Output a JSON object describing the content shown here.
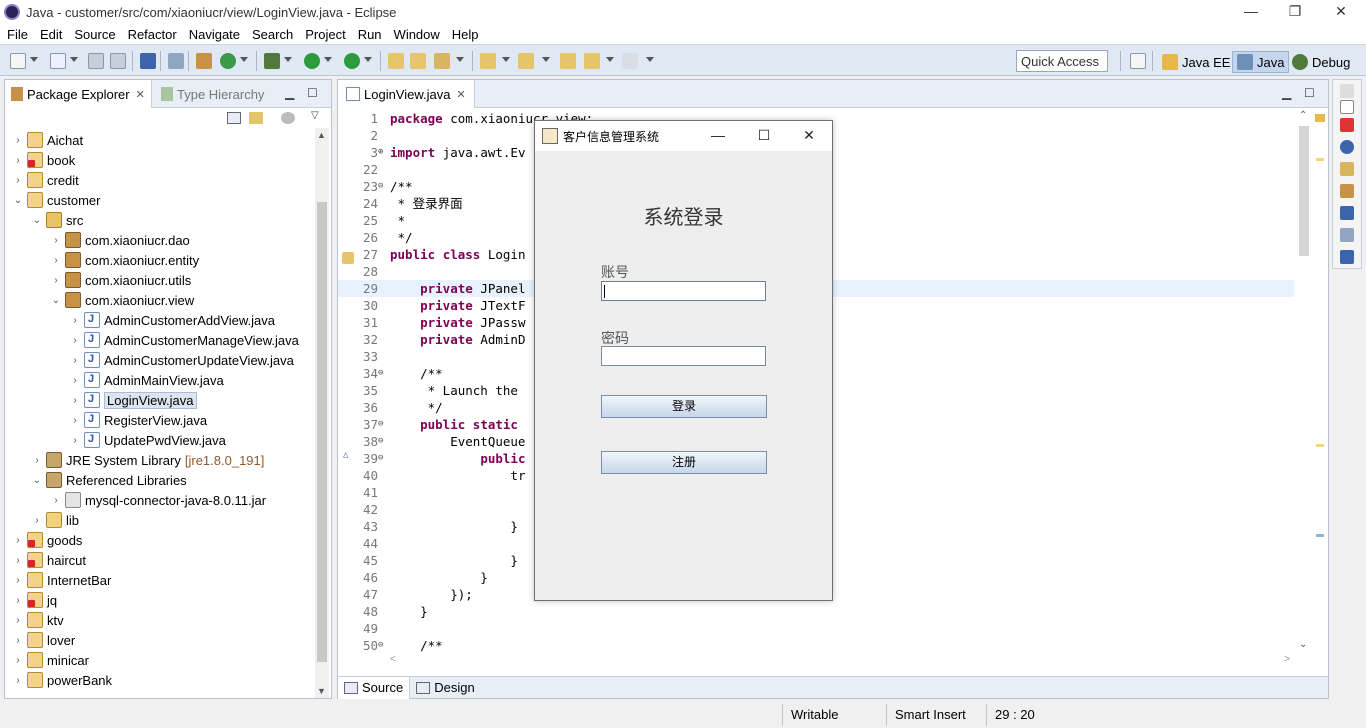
{
  "window": {
    "title": "Java - customer/src/com/xiaoniucr/view/LoginView.java - Eclipse",
    "minimize": "—",
    "maximize": "❐",
    "close": "✕"
  },
  "menu": [
    "File",
    "Edit",
    "Source",
    "Refactor",
    "Navigate",
    "Search",
    "Project",
    "Run",
    "Window",
    "Help"
  ],
  "toolbar": {
    "quick_access": "Quick Access",
    "perspectives": [
      {
        "label": "Java EE",
        "active": false
      },
      {
        "label": "Java",
        "active": true
      },
      {
        "label": "Debug",
        "active": false
      }
    ]
  },
  "package_explorer": {
    "tab_active": "Package Explorer",
    "tab_inactive": "Type Hierarchy",
    "rows": [
      {
        "label": "Aichat",
        "depth": 0,
        "twisty": "›",
        "icon": "project"
      },
      {
        "label": "book",
        "depth": 0,
        "twisty": "›",
        "icon": "project-error"
      },
      {
        "label": "credit",
        "depth": 0,
        "twisty": "›",
        "icon": "project"
      },
      {
        "label": "customer",
        "depth": 0,
        "twisty": "⌄",
        "icon": "project"
      },
      {
        "label": "src",
        "depth": 1,
        "twisty": "⌄",
        "icon": "source-folder"
      },
      {
        "label": "com.xiaoniucr.dao",
        "depth": 2,
        "twisty": "›",
        "icon": "package"
      },
      {
        "label": "com.xiaoniucr.entity",
        "depth": 2,
        "twisty": "›",
        "icon": "package"
      },
      {
        "label": "com.xiaoniucr.utils",
        "depth": 2,
        "twisty": "›",
        "icon": "package"
      },
      {
        "label": "com.xiaoniucr.view",
        "depth": 2,
        "twisty": "⌄",
        "icon": "package"
      },
      {
        "label": "AdminCustomerAddView.java",
        "depth": 3,
        "twisty": "›",
        "icon": "java-file"
      },
      {
        "label": "AdminCustomerManageView.java",
        "depth": 3,
        "twisty": "›",
        "icon": "java-file"
      },
      {
        "label": "AdminCustomerUpdateView.java",
        "depth": 3,
        "twisty": "›",
        "icon": "java-file"
      },
      {
        "label": "AdminMainView.java",
        "depth": 3,
        "twisty": "›",
        "icon": "java-file"
      },
      {
        "label": "LoginView.java",
        "depth": 3,
        "twisty": "›",
        "icon": "java-file",
        "selected": true
      },
      {
        "label": "RegisterView.java",
        "depth": 3,
        "twisty": "›",
        "icon": "java-file"
      },
      {
        "label": "UpdatePwdView.java",
        "depth": 3,
        "twisty": "›",
        "icon": "java-file"
      },
      {
        "label": "JRE System Library",
        "extra": "[jre1.8.0_191]",
        "depth": 1,
        "twisty": "›",
        "icon": "library"
      },
      {
        "label": "Referenced Libraries",
        "depth": 1,
        "twisty": "⌄",
        "icon": "library"
      },
      {
        "label": "mysql-connector-java-8.0.11.jar",
        "depth": 2,
        "twisty": "›",
        "icon": "jar"
      },
      {
        "label": "lib",
        "depth": 1,
        "twisty": "›",
        "icon": "folder"
      },
      {
        "label": "goods",
        "depth": 0,
        "twisty": "›",
        "icon": "project-error"
      },
      {
        "label": "haircut",
        "depth": 0,
        "twisty": "›",
        "icon": "project-error"
      },
      {
        "label": "InternetBar",
        "depth": 0,
        "twisty": "›",
        "icon": "project"
      },
      {
        "label": "jq",
        "depth": 0,
        "twisty": "›",
        "icon": "project-error"
      },
      {
        "label": "ktv",
        "depth": 0,
        "twisty": "›",
        "icon": "project"
      },
      {
        "label": "lover",
        "depth": 0,
        "twisty": "›",
        "icon": "project"
      },
      {
        "label": "minicar",
        "depth": 0,
        "twisty": "›",
        "icon": "project"
      },
      {
        "label": "powerBank",
        "depth": 0,
        "twisty": "›",
        "icon": "project"
      }
    ]
  },
  "editor": {
    "tab": "LoginView.java",
    "current_line": "29",
    "lines": [
      {
        "n": "1",
        "fold": "",
        "code": "package com.xiaoniucr.view;",
        "kind": "kw-first"
      },
      {
        "n": "2",
        "fold": "",
        "code": "",
        "kind": "plain"
      },
      {
        "n": "3",
        "fold": "⊕",
        "code": "import java.awt.Ev",
        "kind": "kw-first"
      },
      {
        "n": "22",
        "fold": "",
        "code": "",
        "kind": "plain"
      },
      {
        "n": "23",
        "fold": "⊖",
        "code": "/**",
        "kind": "comment"
      },
      {
        "n": "24",
        "fold": "",
        "code": " * 登录界面",
        "kind": "comment"
      },
      {
        "n": "25",
        "fold": "",
        "code": " *",
        "kind": "comment"
      },
      {
        "n": "26",
        "fold": "",
        "code": " */",
        "kind": "comment"
      },
      {
        "n": "27",
        "fold": "",
        "code": "public class Login",
        "kind": "kw-two"
      },
      {
        "n": "28",
        "fold": "",
        "code": "",
        "kind": "plain"
      },
      {
        "n": "29",
        "fold": "",
        "code": "    private JPanel",
        "kind": "kw-first"
      },
      {
        "n": "30",
        "fold": "",
        "code": "    private JTextF",
        "kind": "kw-first"
      },
      {
        "n": "31",
        "fold": "",
        "code": "    private JPassw",
        "kind": "kw-first"
      },
      {
        "n": "32",
        "fold": "",
        "code": "    private AdminD",
        "kind": "kw-first"
      },
      {
        "n": "33",
        "fold": "",
        "code": "",
        "kind": "plain"
      },
      {
        "n": "34",
        "fold": "⊖",
        "code": "    /**",
        "kind": "comment"
      },
      {
        "n": "35",
        "fold": "",
        "code": "     * Launch the",
        "kind": "comment"
      },
      {
        "n": "36",
        "fold": "",
        "code": "     */",
        "kind": "comment"
      },
      {
        "n": "37",
        "fold": "⊖",
        "code": "    public static",
        "kind": "kw-two"
      },
      {
        "n": "38",
        "fold": "⊖",
        "code": "        EventQueue",
        "kind": "plain"
      },
      {
        "n": "39",
        "fold": "⊖",
        "code": "            public",
        "kind": "kw-first"
      },
      {
        "n": "40",
        "fold": "",
        "code": "                tr",
        "kind": "kw-first"
      },
      {
        "n": "41",
        "fold": "",
        "code": "",
        "kind": "plain"
      },
      {
        "n": "42",
        "fold": "",
        "code": "",
        "kind": "plain"
      },
      {
        "n": "43",
        "fold": "",
        "code": "                }",
        "kind": "plain"
      },
      {
        "n": "44",
        "fold": "",
        "code": "",
        "kind": "plain"
      },
      {
        "n": "45",
        "fold": "",
        "code": "                }",
        "kind": "plain"
      },
      {
        "n": "46",
        "fold": "",
        "code": "            }",
        "kind": "plain"
      },
      {
        "n": "47",
        "fold": "",
        "code": "        });",
        "kind": "plain"
      },
      {
        "n": "48",
        "fold": "",
        "code": "    }",
        "kind": "plain"
      },
      {
        "n": "49",
        "fold": "",
        "code": "",
        "kind": "plain"
      },
      {
        "n": "50",
        "fold": "⊖",
        "code": "    /**",
        "kind": "comment"
      }
    ],
    "bottom_tabs": [
      "Source",
      "Design"
    ]
  },
  "status": {
    "writable": "Writable",
    "insert_mode": "Smart Insert",
    "position": "29 : 20"
  },
  "dialog": {
    "title": "客户信息管理系统",
    "heading": "系统登录",
    "account_label": "账号",
    "account_value": "",
    "password_label": "密码",
    "password_value": "",
    "login_button": "登录",
    "register_button": "注册",
    "minimize": "—",
    "maximize": "☐",
    "close": "✕"
  },
  "colors": {
    "keyword": "#7f0055",
    "comment": "#3f5fbf",
    "toolbar_bg": "#dfe8f3",
    "current_line": "#e8f2fe"
  }
}
